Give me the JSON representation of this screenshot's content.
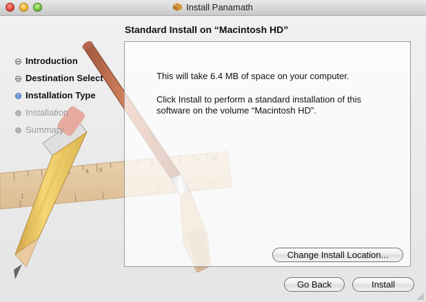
{
  "window": {
    "title": "Install Panamath",
    "heading": "Standard Install on “Macintosh HD”"
  },
  "steps": [
    {
      "label": "Introduction",
      "state": "done"
    },
    {
      "label": "Destination Select",
      "state": "done"
    },
    {
      "label": "Installation Type",
      "state": "current"
    },
    {
      "label": "Installation",
      "state": "pending"
    },
    {
      "label": "Summary",
      "state": "pending"
    }
  ],
  "content": {
    "space_message": "This will take 6.4 MB of space on your computer.",
    "install_message": "Click Install to perform a standard installation of this software on the volume “Macintosh HD”."
  },
  "buttons": {
    "change_location": "Change Install Location...",
    "go_back": "Go Back",
    "install": "Install"
  },
  "colors": {
    "current_step": "#3c7fdc",
    "pending_step": "#9a9a9a"
  },
  "icons": {
    "title": "package-icon",
    "background": "pencil-ruler-brush-artwork"
  }
}
